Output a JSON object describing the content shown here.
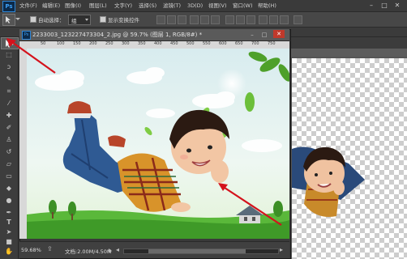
{
  "app": {
    "logo": "Ps"
  },
  "menubar": {
    "items": [
      "文件(F)",
      "编辑(E)",
      "图像(I)",
      "图层(L)",
      "文字(Y)",
      "选择(S)",
      "滤镜(T)",
      "3D(D)",
      "视图(V)",
      "窗口(W)",
      "帮助(H)"
    ],
    "window_controls": [
      "–",
      "□",
      "✕"
    ]
  },
  "options": {
    "auto_select_label": "自动选择：",
    "auto_select_value": "组",
    "show_transform_label": "显示变换控件"
  },
  "document": {
    "title": "2233003_123227473304_2.jpg @ 59.7% (图层 1, RGB/8#) *",
    "ruler_ticks": [
      "50",
      "100",
      "150",
      "200",
      "250",
      "300",
      "350",
      "400",
      "450",
      "500",
      "550",
      "600",
      "650",
      "700",
      "750"
    ],
    "zoom": "59.68%",
    "doc_info": "文档:2.00M/4.50M",
    "window_controls": [
      "–",
      "□",
      "✕"
    ]
  },
  "icons": {
    "move": "move-tool-icon",
    "marquee": "marquee-tool-icon",
    "lasso": "lasso-tool-icon",
    "quick_select": "quick-select-icon",
    "crop": "crop-icon",
    "eyedropper": "eyedropper-icon",
    "heal": "healing-brush-icon",
    "brush": "brush-icon",
    "stamp": "clone-stamp-icon",
    "history": "history-brush-icon",
    "eraser": "eraser-icon",
    "gradient": "gradient-icon",
    "blur": "blur-icon",
    "dodge": "dodge-icon",
    "pen": "pen-icon",
    "type": "type-tool-icon",
    "path_select": "path-select-icon",
    "shape": "rectangle-shape-icon",
    "hand": "hand-tool-icon",
    "zoom": "zoom-tool-icon"
  },
  "colors": {
    "annotation_arrow": "#d4121c",
    "ps_blue": "#2f86d6"
  }
}
